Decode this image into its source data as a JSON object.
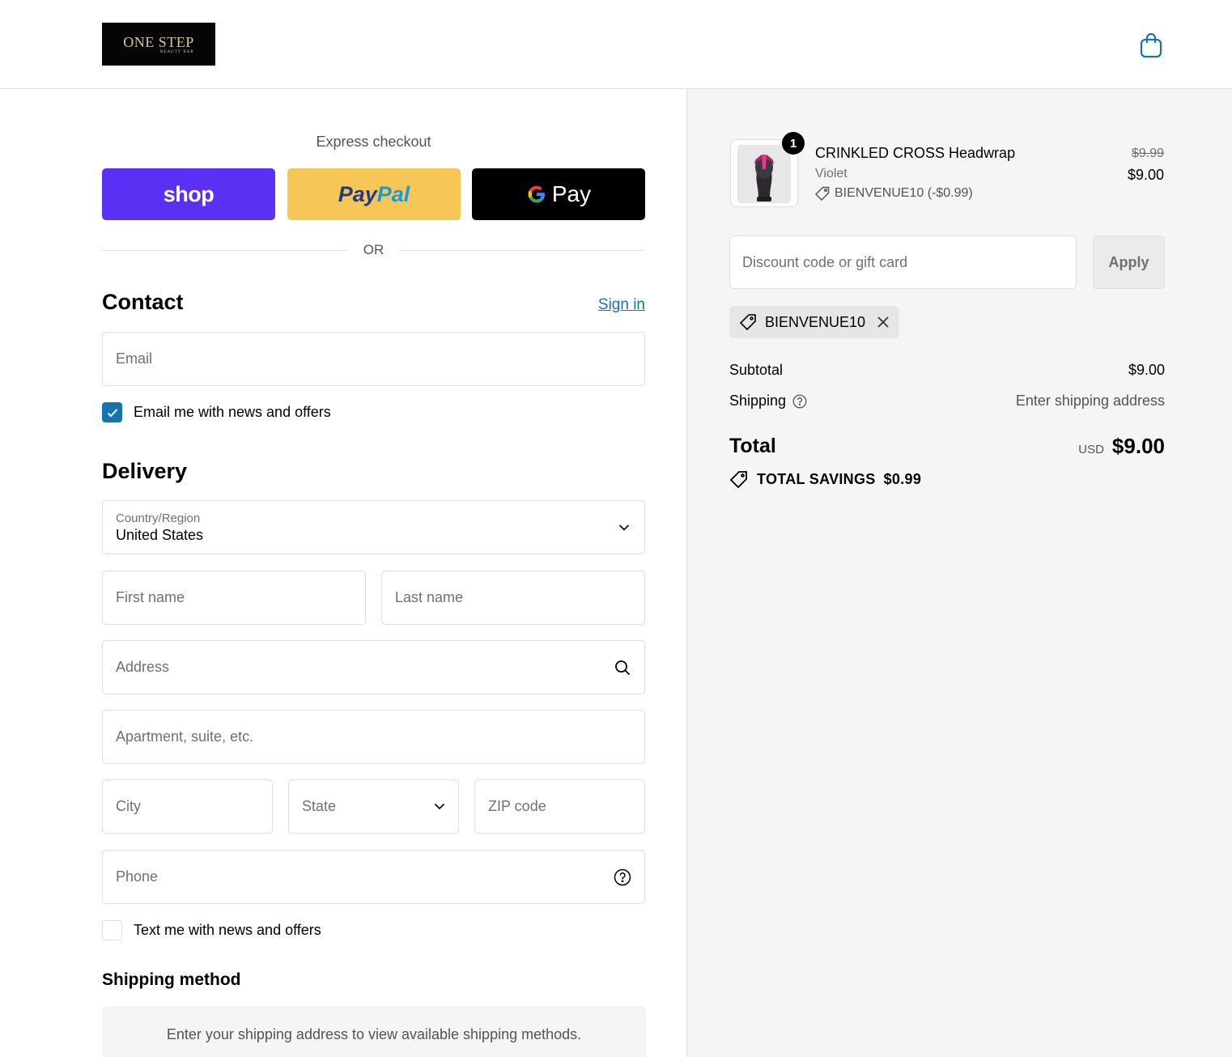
{
  "brand": {
    "logo_text": "ONE STEP",
    "logo_sub": "BEAUTY BAR"
  },
  "express": {
    "title": "Express checkout",
    "shop_label": "shop",
    "paypal_part1": "Pay",
    "paypal_part2": "Pal",
    "gpay_label": "Pay",
    "or_label": "OR"
  },
  "contact": {
    "title": "Contact",
    "sign_in": "Sign in",
    "email_placeholder": "Email",
    "news_label": "Email me with news and offers",
    "news_checked": true
  },
  "delivery": {
    "title": "Delivery",
    "country_label": "Country/Region",
    "country_value": "United States",
    "first_name": "First name",
    "last_name": "Last name",
    "address": "Address",
    "apartment": "Apartment, suite, etc.",
    "city": "City",
    "state": "State",
    "zip": "ZIP code",
    "phone": "Phone",
    "sms_label": "Text me with news and offers",
    "sms_checked": false
  },
  "shipping_method": {
    "title": "Shipping method",
    "message": "Enter your shipping address to view available shipping methods."
  },
  "order": {
    "quantity": "1",
    "product_name": "CRINKLED CROSS Headwrap",
    "variant": "Violet",
    "discount_line": "BIENVENUE10 (-$0.99)",
    "price_original": "$9.99",
    "price_final": "$9.00",
    "discount_placeholder": "Discount code or gift card",
    "apply_label": "Apply",
    "applied_code": "BIENVENUE10",
    "subtotal_label": "Subtotal",
    "subtotal_value": "$9.00",
    "shipping_label": "Shipping",
    "shipping_value": "Enter shipping address",
    "total_label": "Total",
    "total_currency": "USD",
    "total_value": "$9.00",
    "savings_label": "TOTAL SAVINGS",
    "savings_value": "$0.99"
  },
  "colors": {
    "accent_link": "#1773b0",
    "shop_pay": "#5a31f4",
    "paypal_yellow": "#f6c757",
    "sidebar_bg": "#f5f5f5"
  }
}
